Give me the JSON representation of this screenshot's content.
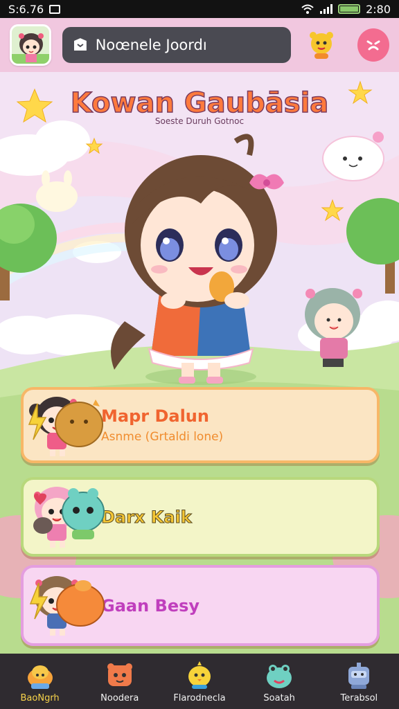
{
  "status": {
    "time_left": "S:6.76",
    "time_right": "2:80"
  },
  "header": {
    "search_placeholder": "Noœnele Joordı"
  },
  "game": {
    "title": "Kowan Gaubāsia",
    "subtitle": "Soeste Duruh Gotnoc"
  },
  "cards": [
    {
      "title": "Mapr Dalun",
      "subtitle": "Asnme (Grtaldi lone)"
    },
    {
      "title": "Darx Kaik"
    },
    {
      "title": "Gaan Besy"
    }
  ],
  "nav": [
    {
      "label": "BaoNgrh",
      "icon": "bread-icon",
      "active": true
    },
    {
      "label": "Noodera",
      "icon": "bear-icon"
    },
    {
      "label": "Flarodnecla",
      "icon": "chick-icon"
    },
    {
      "label": "Soatah",
      "icon": "frog-icon"
    },
    {
      "label": "Terabsol",
      "icon": "robot-icon"
    }
  ],
  "colors": {
    "accent": "#f36c90",
    "nav_bg": "#2f2b30",
    "header_bg": "#f1c7df"
  }
}
